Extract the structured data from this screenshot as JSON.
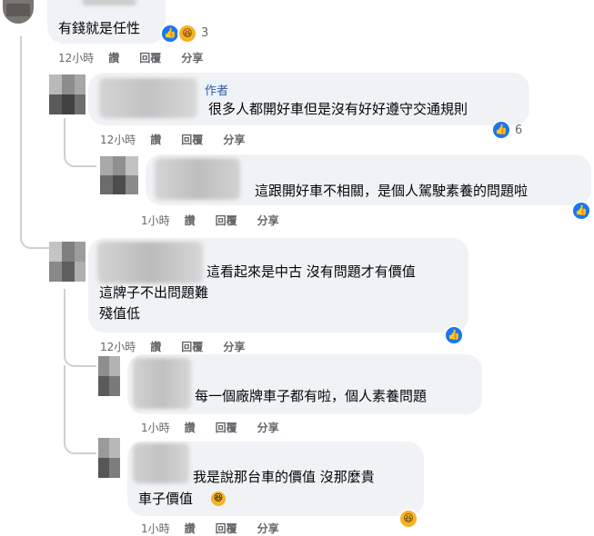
{
  "comments": [
    {
      "id": "c1",
      "text": "有錢就是任性",
      "reaction_count": "3",
      "time": "12小時",
      "actions": [
        "讚",
        "回覆",
        "分享"
      ]
    },
    {
      "id": "c2",
      "author_badge": "作者",
      "text": "很多人都開好車但是沒有好好遵守交通規則",
      "reaction_count": "6",
      "time": "12小時",
      "actions": [
        "讚",
        "回覆",
        "分享"
      ]
    },
    {
      "id": "c3",
      "text": "這跟開好車不相關，是個人駕駛素養的問題啦",
      "time": "1小時",
      "actions": [
        "讚",
        "回覆",
        "分享"
      ]
    },
    {
      "id": "c4",
      "lines": [
        "這看起來是中古 沒有問題才有價值",
        "這牌子不出問題難",
        "殘值低"
      ],
      "time": "12小時",
      "actions": [
        "讚",
        "回覆",
        "分享"
      ]
    },
    {
      "id": "c5",
      "text": "每一個廠牌車子都有啦，個人素養問題",
      "time": "1小時",
      "actions": [
        "讚",
        "回覆",
        "分享"
      ]
    },
    {
      "id": "c6",
      "lines": [
        "我是說那台車的價值 沒那麼貴",
        "車子價值"
      ],
      "time": "1小時",
      "actions": [
        "讚",
        "回覆",
        "分享"
      ]
    }
  ],
  "icons": {
    "like": "like-icon",
    "haha": "haha-icon"
  },
  "colors": {
    "bubble": "#f0f2f5",
    "meta": "#65676b",
    "like": "#1877f2",
    "haha": "#f7b125"
  }
}
